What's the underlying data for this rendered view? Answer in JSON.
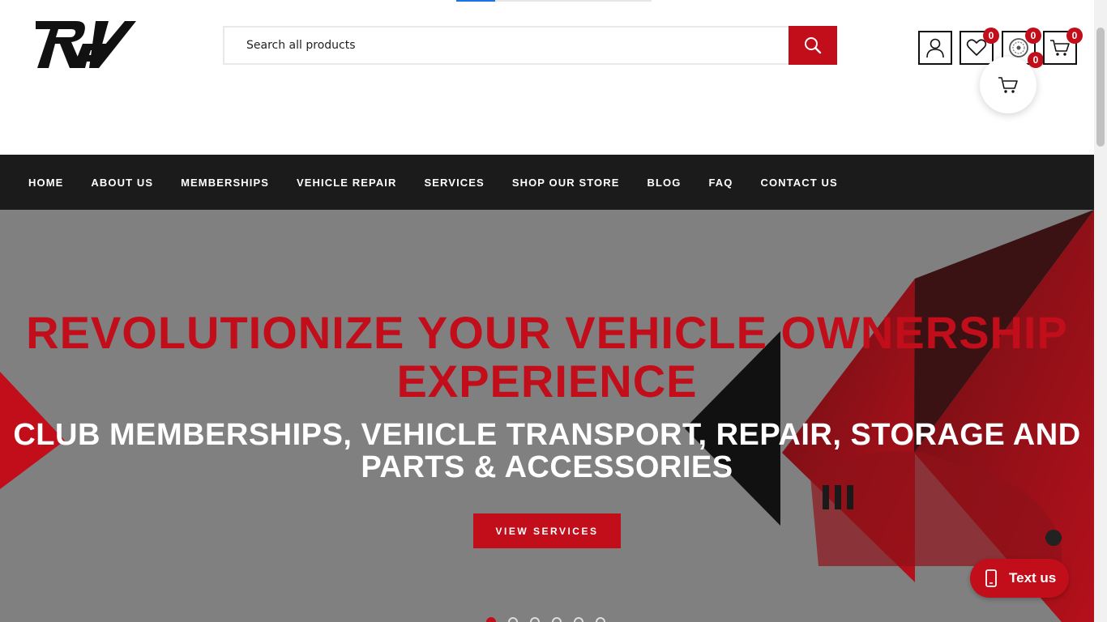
{
  "brand": {
    "logo_text": "REV",
    "accent_color": "#c20e1a",
    "nav_bg": "#1b1b1b"
  },
  "search": {
    "placeholder": "Search all products",
    "icon": "search-icon"
  },
  "header_icons": {
    "account": {
      "icon": "user-icon"
    },
    "wishlist": {
      "icon": "heart-icon",
      "count": "0"
    },
    "compare": {
      "icon": "wheel-icon",
      "count": "0",
      "count_secondary": "0"
    },
    "cart": {
      "icon": "cart-icon",
      "count": "0"
    }
  },
  "nav": {
    "items": [
      {
        "label": "HOME"
      },
      {
        "label": "ABOUT US"
      },
      {
        "label": "MEMBERSHIPS"
      },
      {
        "label": "VEHICLE REPAIR"
      },
      {
        "label": "SERVICES"
      },
      {
        "label": "SHOP OUR STORE"
      },
      {
        "label": "BLOG"
      },
      {
        "label": "FAQ"
      },
      {
        "label": "CONTACT US"
      }
    ]
  },
  "hero": {
    "title_line1": "REVOLUTIONIZE YOUR VEHICLE OWNERSHIP",
    "title_line2": "EXPERIENCE",
    "subtitle_line1": "CLUB MEMBERSHIPS, VEHICLE TRANSPORT, REPAIR, STORAGE AND",
    "subtitle_line2": "PARTS & ACCESSORIES",
    "button_label": "VIEW SERVICES",
    "slides": 6,
    "active_slide": 1
  },
  "chat": {
    "label": "Text us",
    "icon": "phone-icon"
  }
}
